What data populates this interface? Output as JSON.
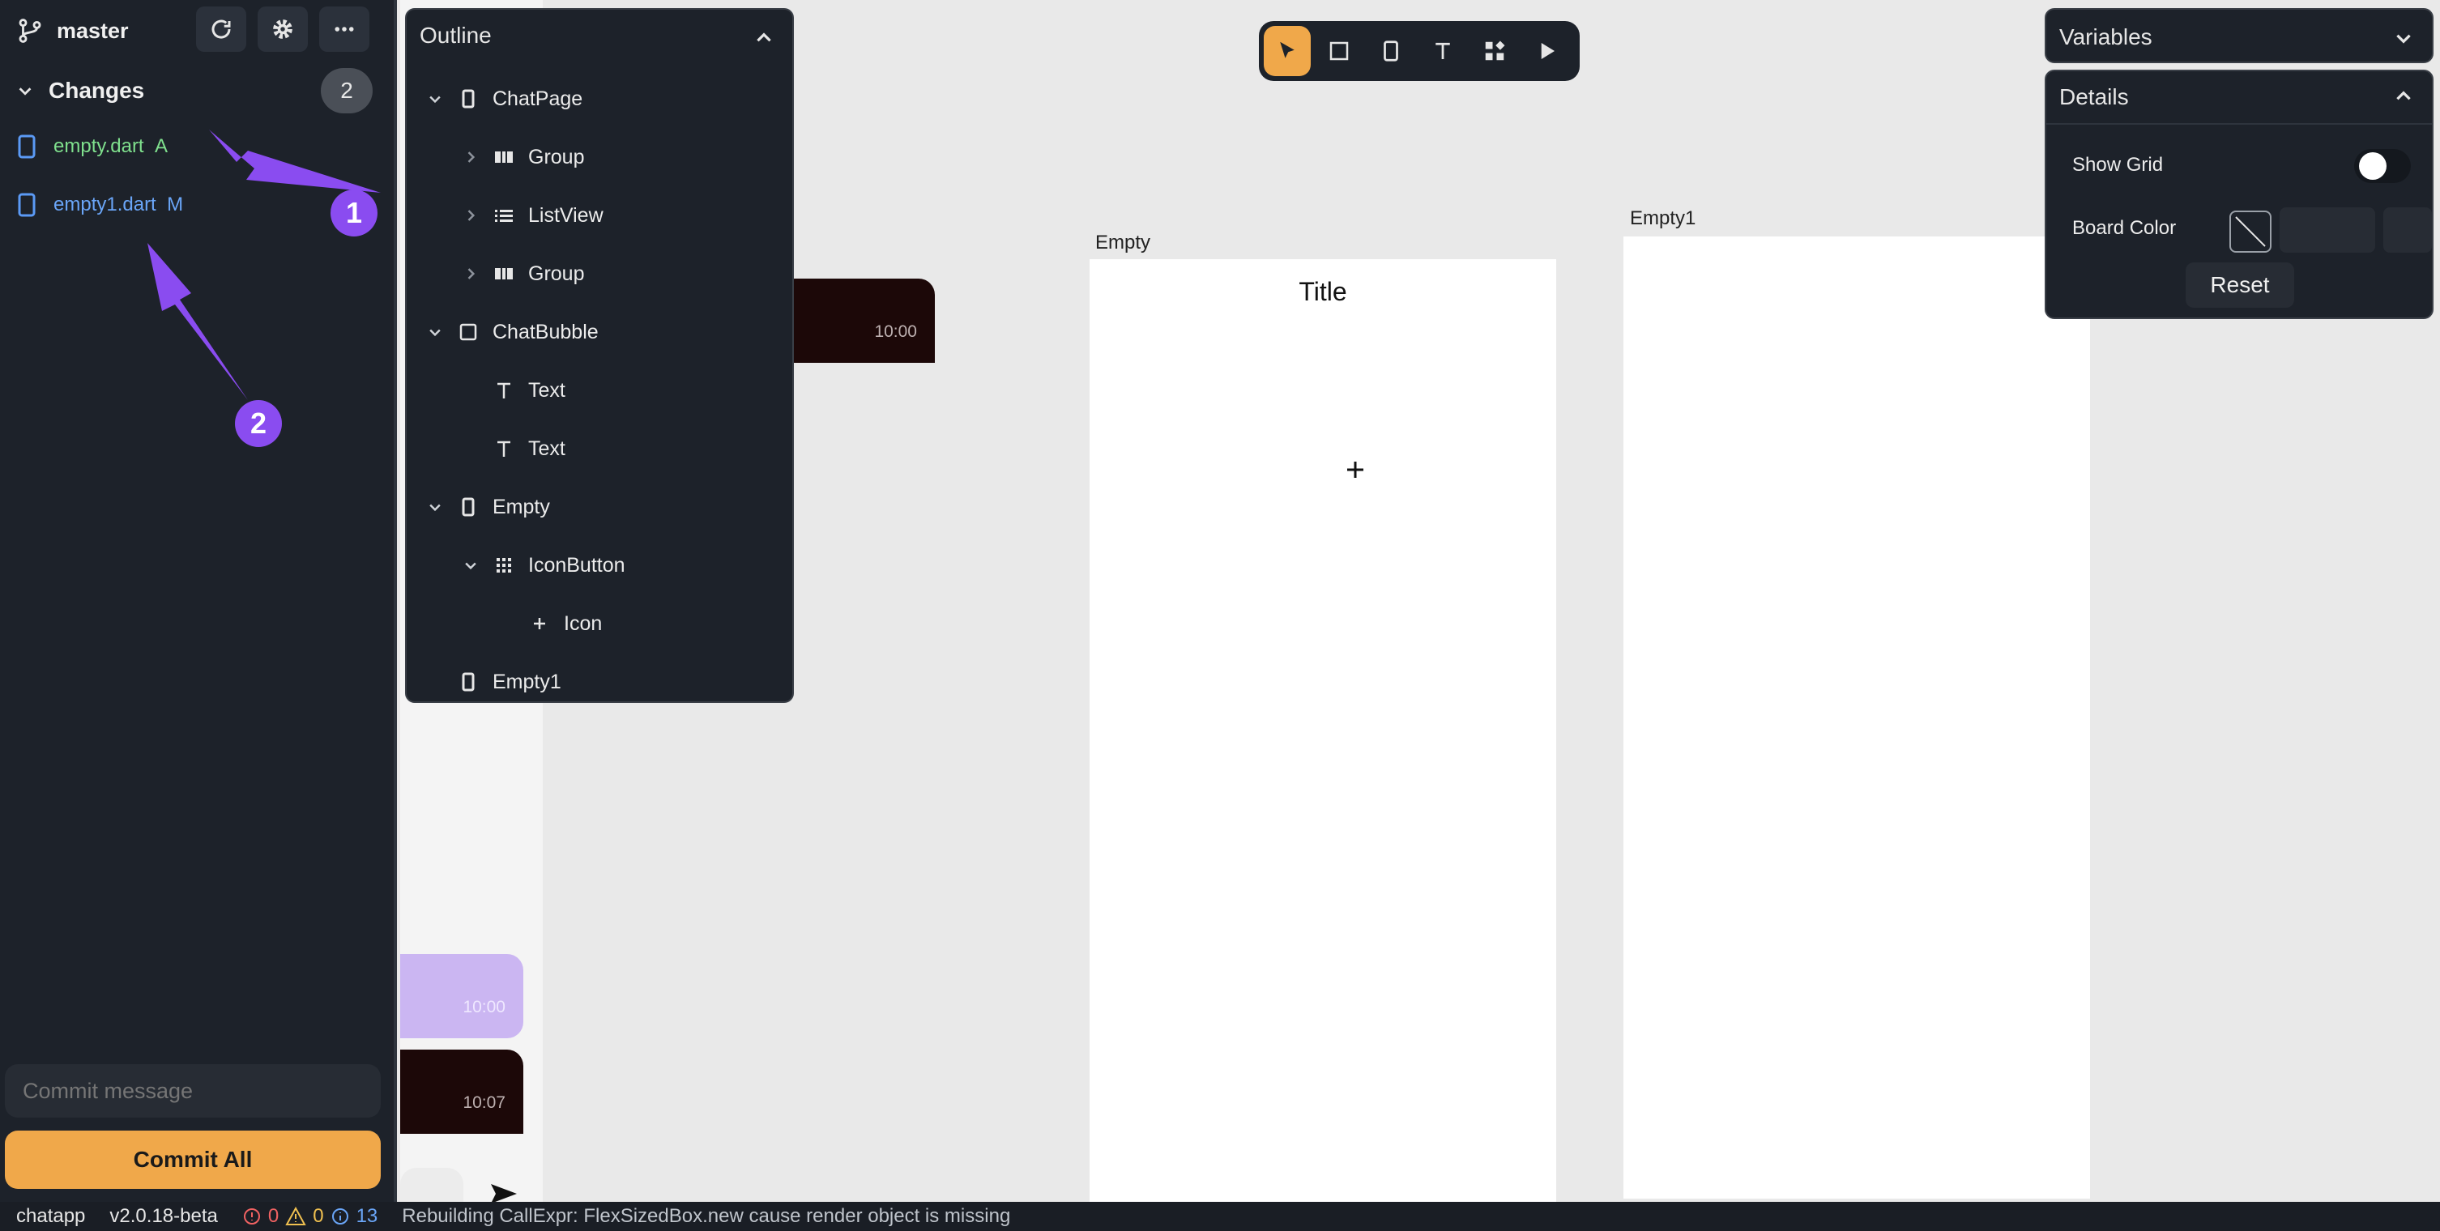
{
  "source_control": {
    "branch": "master",
    "changes_label": "Changes",
    "changes_count": "2",
    "files": [
      {
        "name": "empty.dart",
        "status": "A"
      },
      {
        "name": "empty1.dart",
        "status": "M"
      }
    ],
    "commit_placeholder": "Commit message",
    "commit_button": "Commit All"
  },
  "annotations": {
    "marker_1": "1",
    "marker_2": "2",
    "arrow_color": "#8a4cf0"
  },
  "outline": {
    "title": "Outline",
    "items": [
      {
        "label": "ChatPage",
        "icon": "phone-icon",
        "expander": "expanded"
      },
      {
        "label": "Group",
        "icon": "group-icon",
        "expander": "collapsed"
      },
      {
        "label": "ListView",
        "icon": "list-icon",
        "expander": "collapsed"
      },
      {
        "label": "Group",
        "icon": "group-icon",
        "expander": "collapsed"
      },
      {
        "label": "ChatBubble",
        "icon": "container-icon",
        "expander": "expanded"
      },
      {
        "label": "Text",
        "icon": "text-icon",
        "expander": "none"
      },
      {
        "label": "Text",
        "icon": "text-icon",
        "expander": "none"
      },
      {
        "label": "Empty",
        "icon": "phone-icon",
        "expander": "expanded"
      },
      {
        "label": "IconButton",
        "icon": "grid-icon",
        "expander": "expanded"
      },
      {
        "label": "Icon",
        "icon": "plus-icon",
        "expander": "none"
      },
      {
        "label": "Empty1",
        "icon": "phone-icon",
        "expander": "none"
      }
    ]
  },
  "toolbar": {
    "tools": [
      "select-arrow-icon",
      "rectangle-icon",
      "phone-icon",
      "text-icon",
      "widgets-icon",
      "play-icon"
    ],
    "active_tool": "select-arrow-icon",
    "accent": "#f0a84a"
  },
  "canvas": {
    "bubble_times": [
      "10:00",
      "10:00",
      "10:07"
    ],
    "boards": [
      {
        "name": "Empty",
        "title_text": "Title",
        "content_icon": "plus-icon"
      },
      {
        "name": "Empty1"
      }
    ]
  },
  "variables_panel": {
    "title": "Variables"
  },
  "details_panel": {
    "title": "Details",
    "show_grid_label": "Show Grid",
    "show_grid_on": false,
    "board_color_label": "Board Color",
    "reset_label": "Reset"
  },
  "status_bar": {
    "project": "chatapp",
    "version": "v2.0.18-beta",
    "errors": "0",
    "warnings": "0",
    "infos": "13",
    "message": "Rebuilding CallExpr: FlexSizedBox.new cause render object is missing"
  }
}
